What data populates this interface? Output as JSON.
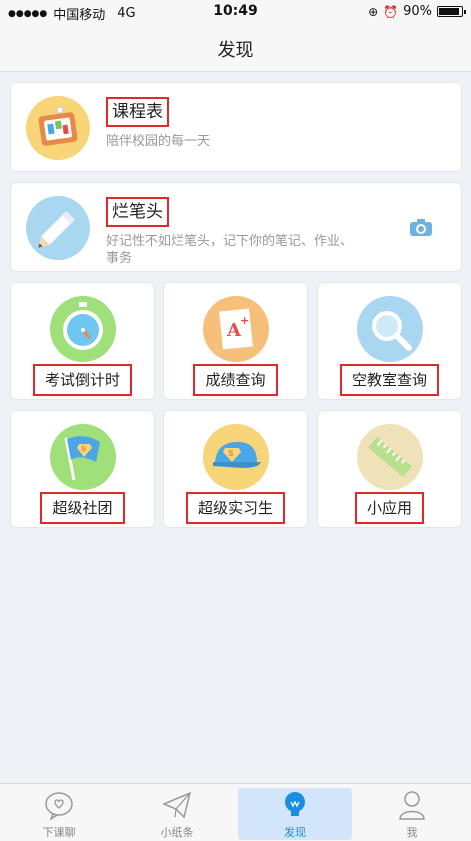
{
  "status_bar": {
    "signal": "●●●●●",
    "carrier": "中国移动",
    "network": "4G",
    "time": "10:49",
    "battery": "90%"
  },
  "nav": {
    "title": "发现"
  },
  "cards": [
    {
      "title": "课程表",
      "subtitle": "陪伴校园的每一天",
      "icon": "schedule-board-icon",
      "color": "#f7d578"
    },
    {
      "title": "烂笔头",
      "subtitle": "好记性不如烂笔头，记下你的笔记、作业、事务",
      "icon": "pencil-icon",
      "color": "#a9d6f0"
    }
  ],
  "tiles": [
    {
      "label": "考试倒计时",
      "icon": "stopwatch-icon",
      "color": "#9fe07a"
    },
    {
      "label": "成绩查询",
      "icon": "grade-paper-icon",
      "color": "#f7c07a"
    },
    {
      "label": "空教室查询",
      "icon": "magnifier-icon",
      "color": "#a9d6f0"
    },
    {
      "label": "超级社团",
      "icon": "flag-icon",
      "color": "#9fe07a"
    },
    {
      "label": "超级实习生",
      "icon": "cap-icon",
      "color": "#f7d578"
    },
    {
      "label": "小应用",
      "icon": "ruler-icon",
      "color": "#efe2b8"
    }
  ],
  "tabbar": [
    {
      "label": "下课聊",
      "icon": "chat-heart-icon"
    },
    {
      "label": "小纸条",
      "icon": "paper-plane-icon"
    },
    {
      "label": "发现",
      "icon": "lightbulb-icon",
      "active": true
    },
    {
      "label": "我",
      "icon": "person-icon"
    }
  ],
  "accent_color": "#1a8fe0",
  "highlight_color": "#e02a2a"
}
